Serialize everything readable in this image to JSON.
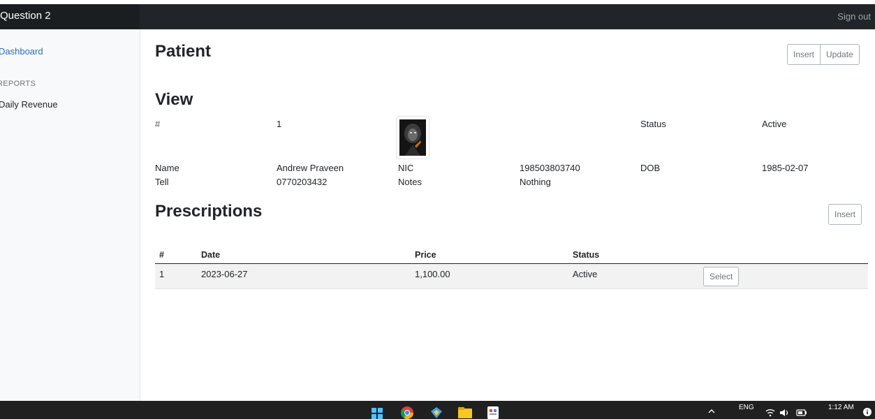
{
  "navbar": {
    "brand": "Question 2",
    "signout": "Sign out"
  },
  "sidebar": {
    "active_item": "Dashboard",
    "reports_heading": "REPORTS",
    "reports_items": [
      "Daily Revenue"
    ]
  },
  "patient": {
    "title": "Patient",
    "insert_label": "Insert",
    "update_label": "Update"
  },
  "view": {
    "title": "View",
    "id_label": "#",
    "id_value": "1",
    "status_label": "Status",
    "status_value": "Active",
    "name_label": "Name",
    "name_value": "Andrew Praveen",
    "nic_label": "NIC",
    "nic_value": "198503803740",
    "dob_label": "DOB",
    "dob_value": "1985-02-07",
    "tell_label": "Tell",
    "tell_value": "0770203432",
    "notes_label": "Notes",
    "notes_value": "Nothing"
  },
  "prescriptions": {
    "title": "Prescriptions",
    "insert_label": "Insert",
    "columns": [
      "#",
      "Date",
      "Price",
      "Status"
    ],
    "rows": [
      {
        "id": "1",
        "date": "2023-06-27",
        "price": "1,100.00",
        "status": "Active",
        "action": "Select"
      }
    ]
  },
  "taskbar": {
    "icons": [
      "windows-start-icon",
      "chrome-icon",
      "app-icon",
      "file-explorer-icon",
      "notepad-icon"
    ],
    "language": "ENG",
    "time": "1:12 AM"
  }
}
